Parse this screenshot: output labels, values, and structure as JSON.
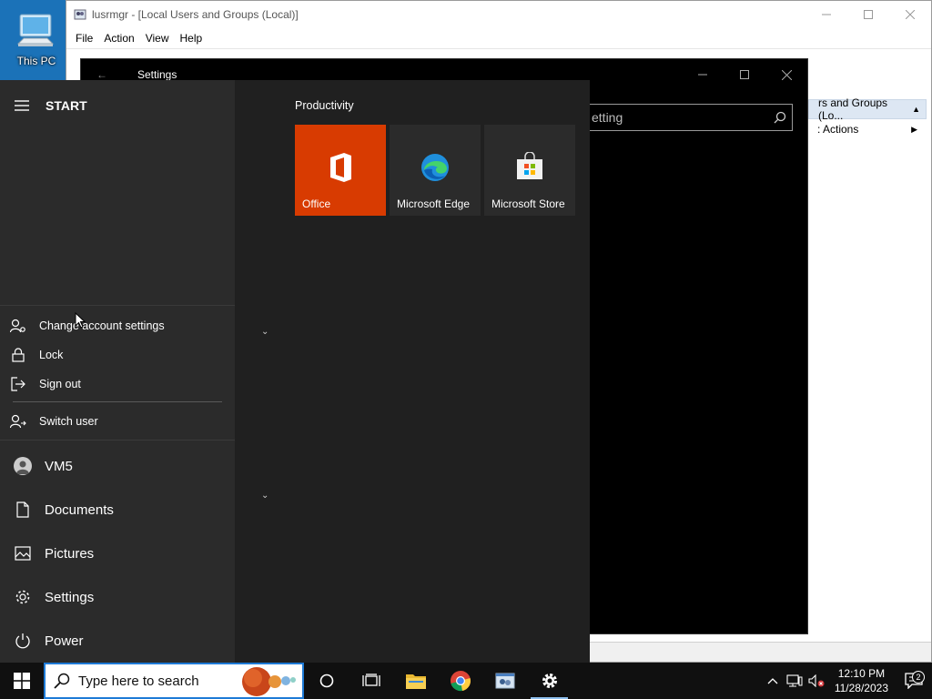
{
  "desktop": {
    "this_pc_label": "This PC"
  },
  "lusrmgr": {
    "title": "lusrmgr - [Local Users and Groups (Local)]",
    "menu": [
      "File",
      "Action",
      "View",
      "Help"
    ],
    "actions_header": "rs and Groups (Lo...",
    "actions_sub": ": Actions"
  },
  "settings_window": {
    "title": "Settings",
    "search_placeholder": "etting"
  },
  "start_menu": {
    "header": "START",
    "account_menu": [
      {
        "label": "Change account settings",
        "icon": "person-gear-icon"
      },
      {
        "label": "Lock",
        "icon": "lock-icon"
      },
      {
        "label": "Sign out",
        "icon": "sign-out-icon"
      },
      {
        "label": "Switch user",
        "icon": "switch-user-icon"
      }
    ],
    "nav": [
      {
        "label": "VM5",
        "icon": "avatar-icon"
      },
      {
        "label": "Documents",
        "icon": "document-icon"
      },
      {
        "label": "Pictures",
        "icon": "picture-icon"
      },
      {
        "label": "Settings",
        "icon": "gear-icon"
      },
      {
        "label": "Power",
        "icon": "power-icon"
      }
    ],
    "tile_group": "Productivity",
    "tiles": [
      {
        "label": "Office",
        "color": "#d83b01",
        "icon": "office-icon"
      },
      {
        "label": "Microsoft Edge",
        "color": "#2b2b2b",
        "icon": "edge-icon"
      },
      {
        "label": "Microsoft Store",
        "color": "#2b2b2b",
        "icon": "store-icon"
      }
    ]
  },
  "taskbar": {
    "search_placeholder": "Type here to search",
    "time": "12:10 PM",
    "date": "11/28/2023",
    "notification_count": "2"
  },
  "colors": {
    "accent": "#1e7ad6",
    "start_bg": "#202020",
    "start_left_bg": "#2b2b2b",
    "taskbar_bg": "#101010"
  }
}
